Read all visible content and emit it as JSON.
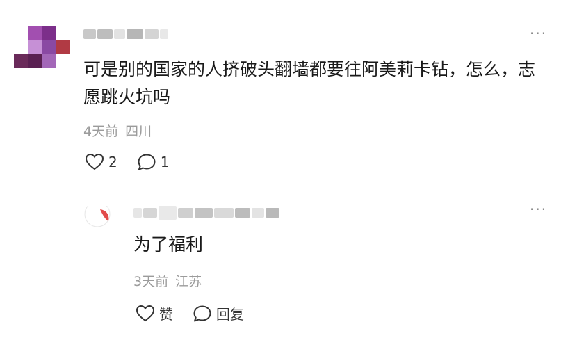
{
  "comment": {
    "more_label": "···",
    "text": "可是别的国家的人挤破头翻墙都要往阿美莉卡钻，怎么，志愿跳火坑吗",
    "time": "4天前",
    "location": "四川",
    "like_count": "2",
    "reply_count": "1",
    "icons": [
      "heart-icon",
      "speech-bubble-icon"
    ]
  },
  "reply": {
    "more_label": "···",
    "text": "为了福利",
    "time": "3天前",
    "location": "江苏",
    "like_label": "赞",
    "reply_label": "回复",
    "icons": [
      "heart-icon",
      "speech-bubble-icon"
    ]
  }
}
